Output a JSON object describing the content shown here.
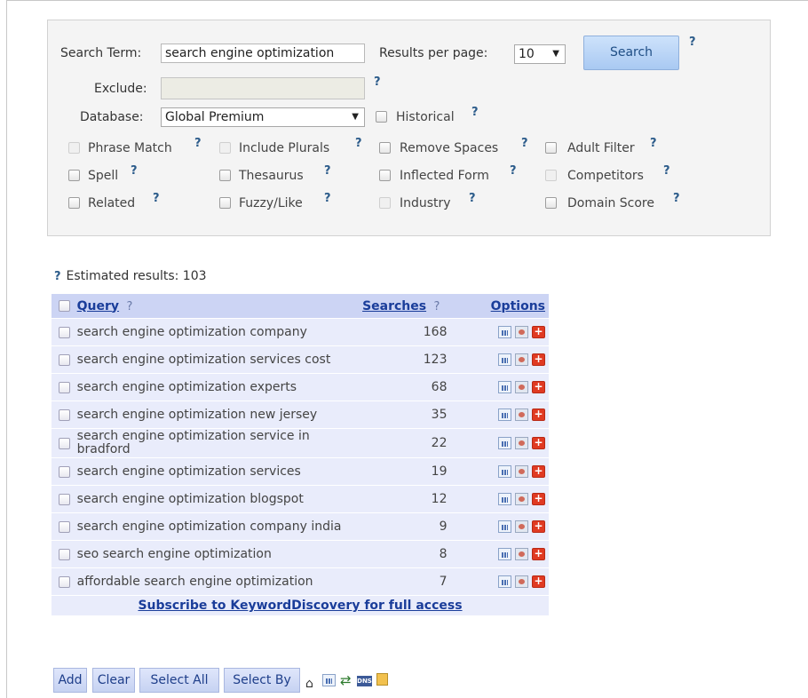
{
  "search": {
    "term_label": "Search Term:",
    "term_value": "search engine optimization",
    "results_per_page_label": "Results per page:",
    "results_per_page_value": "10",
    "search_button": "Search",
    "exclude_label": "Exclude:",
    "exclude_value": "",
    "database_label": "Database:",
    "database_value": "Global Premium",
    "historical_label": "Historical",
    "help_mark": "?"
  },
  "options": {
    "phrase_match": "Phrase Match",
    "include_plurals": "Include Plurals",
    "remove_spaces": "Remove Spaces",
    "adult_filter": "Adult Filter",
    "spell": "Spell",
    "thesaurus": "Thesaurus",
    "inflected_form": "Inflected Form",
    "competitors": "Competitors",
    "related": "Related",
    "fuzzy_like": "Fuzzy/Like",
    "industry": "Industry",
    "domain_score": "Domain Score"
  },
  "results": {
    "estimated_label": "Estimated results: 103",
    "col_query": "Query",
    "col_searches": "Searches",
    "col_options": "Options",
    "rows": [
      {
        "query": "search engine optimization company",
        "searches": "168"
      },
      {
        "query": "search engine optimization services cost",
        "searches": "123"
      },
      {
        "query": "search engine optimization experts",
        "searches": "68"
      },
      {
        "query": "search engine optimization new jersey",
        "searches": "35"
      },
      {
        "query": "search engine optimization service in bradford",
        "searches": "22"
      },
      {
        "query": "search engine optimization services",
        "searches": "19"
      },
      {
        "query": "search engine optimization blogspot",
        "searches": "12"
      },
      {
        "query": "search engine optimization company india",
        "searches": "9"
      },
      {
        "query": "seo search engine optimization",
        "searches": "8"
      },
      {
        "query": "affordable search engine optimization",
        "searches": "7"
      }
    ],
    "subscribe_link": "Subscribe to KeywordDiscovery for full access"
  },
  "actions": {
    "add": "Add",
    "clear": "Clear",
    "select_all": "Select All",
    "select_by": "Select By"
  },
  "icons": [
    "trash-icon",
    "chart-icon",
    "export-icon",
    "dns-icon",
    "notes-icon"
  ]
}
